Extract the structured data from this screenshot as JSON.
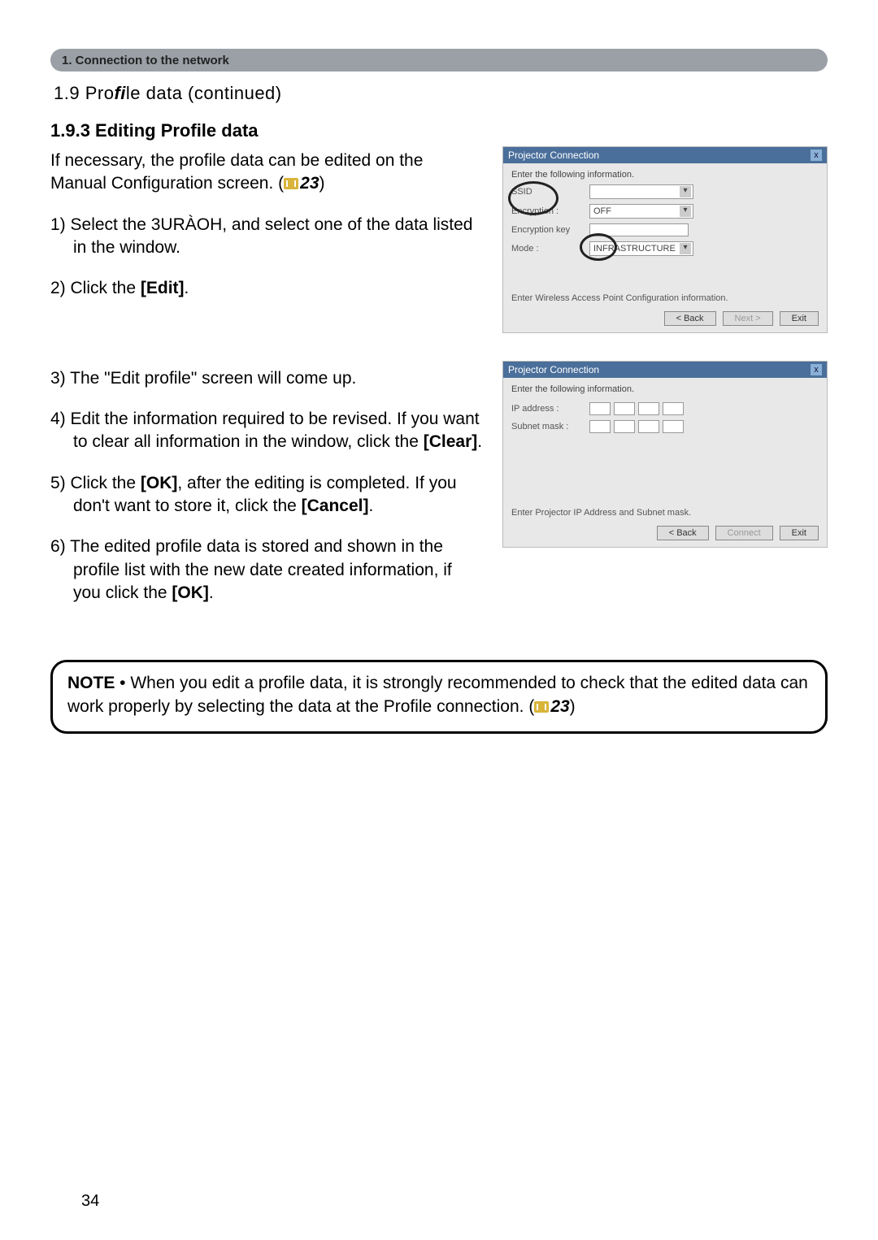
{
  "section_bar": "1. Connection to the network",
  "continued_prefix": "1.9 Pro",
  "continued_fi": "fi",
  "continued_suffix": "le data (continued)",
  "subheading": "1.9.3 Editing Profile data",
  "intro_a": "If necessary, the proﬁle data can be edited on the Manual Conﬁguration screen. (",
  "intro_ref": "23",
  "intro_b": ")",
  "step1_a": "1) Select the 3URÀOH, and select one of the data listed in the window.",
  "step2_a": "2) Click the ",
  "step2_bold": "[Edit]",
  "step2_b": ".",
  "step3": "3) The \"Edit proﬁle\" screen will come up.",
  "step4_a": "4) Edit the information required to be revised. If you want to clear all information in the window, click the ",
  "step4_bold": "[Clear]",
  "step4_b": ".",
  "step5_a": "5) Click the ",
  "step5_bold1": "[OK]",
  "step5_mid": ", after the editing is completed. If you don't want to store it, click the ",
  "step5_bold2": "[Cancel]",
  "step5_b": ".",
  "step6_a": "6) The edited proﬁle data is stored and shown in the proﬁle list with the new date created information, if you click the ",
  "step6_bold": "[OK]",
  "step6_b": ".",
  "note_label": "NOTE",
  "note_a": " • When you edit a proﬁle data, it is strongly recommended to check that the edited data can work properly by selecting the data at the Proﬁle connection. (",
  "note_ref": "23",
  "note_b": ")",
  "page_number": "34",
  "shot1": {
    "title": "Projector Connection",
    "prompt": "Enter the following information.",
    "rows": {
      "ssid": "SSID",
      "encryption_label": "Encryption",
      "encryption_value": "OFF",
      "enc_key": "Encryption key",
      "mode_label": "Mode",
      "mode_value": "INFRASTRUCTURE"
    },
    "hint": "Enter Wireless Access Point Configuration information.",
    "back": "< Back",
    "next": "Next >",
    "exit": "Exit"
  },
  "shot2": {
    "title": "Projector Connection",
    "prompt": "Enter the following information.",
    "ip_label": "IP address",
    "mask_label": "Subnet mask",
    "hint": "Enter Projector IP Address and Subnet mask.",
    "back": "< Back",
    "connect": "Connect",
    "exit": "Exit"
  }
}
